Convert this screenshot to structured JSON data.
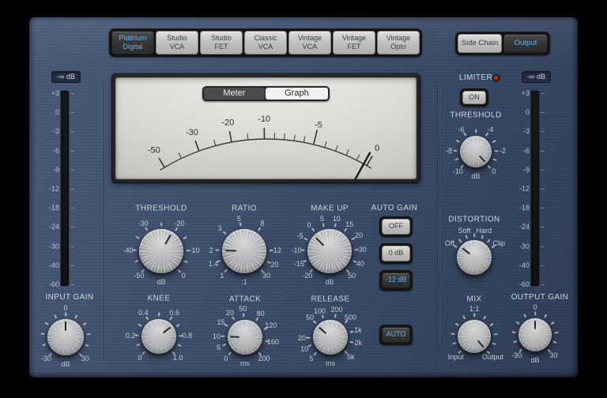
{
  "colors": {
    "accent_blue": "#6cb0ef",
    "panel_blue": "#3a4a66",
    "led_red": "#7c150d"
  },
  "model_selector": {
    "items": [
      {
        "lines": [
          "Platinum",
          "Digital"
        ],
        "selected": true
      },
      {
        "lines": [
          "Studio",
          "VCA"
        ],
        "selected": false
      },
      {
        "lines": [
          "Studio",
          "FET"
        ],
        "selected": false
      },
      {
        "lines": [
          "Classic",
          "VCA"
        ],
        "selected": false
      },
      {
        "lines": [
          "Vintage",
          "VCA"
        ],
        "selected": false
      },
      {
        "lines": [
          "Vintage",
          "FET"
        ],
        "selected": false
      },
      {
        "lines": [
          "Vintage",
          "Opto"
        ],
        "selected": false
      }
    ]
  },
  "output_selector": {
    "items": [
      {
        "label": "Side Chain",
        "selected": false
      },
      {
        "label": "Output",
        "selected": true
      }
    ]
  },
  "vu": {
    "tabs": [
      {
        "label": "Meter",
        "selected": true
      },
      {
        "label": "Graph",
        "selected": false
      }
    ],
    "scale": {
      "major": [
        {
          "text": "-50",
          "angle": -31
        },
        {
          "text": "-30",
          "angle": -20
        },
        {
          "text": "-20",
          "angle": -10.3
        },
        {
          "text": "-10",
          "angle": -0.8
        },
        {
          "text": "-5",
          "angle": 13.5,
          "long": true
        },
        {
          "text": "0",
          "angle": 30
        }
      ],
      "minor_angles": [
        -25.5,
        -15,
        -5.5,
        2.1,
        4.9,
        7.8,
        10.6,
        16.8,
        20.1,
        23.4,
        26.7
      ],
      "needle_angle": 29
    }
  },
  "meters": {
    "input": {
      "top_label": "-∞ dB",
      "ticks": [
        "+3",
        "0",
        "-3",
        "-6",
        "-9",
        "-12",
        "-18",
        "-24",
        "-30",
        "-40",
        "-60"
      ],
      "bottom_label": "INPUT GAIN"
    },
    "output": {
      "top_label": "-∞ dB",
      "ticks": [
        "+3",
        "0",
        "-3",
        "-6",
        "-9",
        "-12",
        "-18",
        "-24",
        "-30",
        "-40",
        "-60"
      ],
      "bottom_label": "OUTPUT GAIN"
    }
  },
  "auto_gain": {
    "label": "AUTO GAIN",
    "options": [
      {
        "label": "OFF",
        "selected": false
      },
      {
        "label": "0 dB",
        "selected": false
      },
      {
        "label": "-12 dB",
        "selected": true
      }
    ]
  },
  "release_auto": {
    "buttons": [
      {
        "label": "AUTO",
        "selected": true
      }
    ]
  },
  "limiter": {
    "label": "LIMITER",
    "buttons": [
      {
        "label": "ON",
        "selected": false
      }
    ]
  },
  "knobs": {
    "threshold": {
      "title": "THRESHOLD",
      "unit": "dB",
      "pointer": 30,
      "labels": [
        {
          "t": "-50",
          "a": -138
        },
        {
          "t": "-40",
          "a": -88
        },
        {
          "t": "-30",
          "a": -33
        },
        {
          "t": "-20",
          "a": 33
        },
        {
          "t": "-10",
          "a": 88
        },
        {
          "t": "0",
          "a": 138
        }
      ]
    },
    "ratio": {
      "title": "RATIO",
      "unit": ":1",
      "pointer": -88,
      "labels": [
        {
          "t": "1",
          "a": -138
        },
        {
          "t": "1.4",
          "a": -112
        },
        {
          "t": "2",
          "a": -88
        },
        {
          "t": "3",
          "a": -47
        },
        {
          "t": "5",
          "a": -9
        },
        {
          "t": "8",
          "a": 33
        },
        {
          "t": "12",
          "a": 88
        },
        {
          "t": "20",
          "a": 114
        },
        {
          "t": "30",
          "a": 138
        }
      ]
    },
    "makeup": {
      "title": "MAKE UP",
      "unit": "dB",
      "pointer": -46,
      "labels": [
        {
          "t": "-20",
          "a": -138
        },
        {
          "t": "-15",
          "a": -113
        },
        {
          "t": "-10",
          "a": -88
        },
        {
          "t": "-5",
          "a": -63
        },
        {
          "t": "0",
          "a": -38
        },
        {
          "t": "5",
          "a": -13
        },
        {
          "t": "10",
          "a": 12
        },
        {
          "t": "15",
          "a": 37
        },
        {
          "t": "20",
          "a": 62
        },
        {
          "t": "30",
          "a": 87
        },
        {
          "t": "40",
          "a": 112
        },
        {
          "t": "50",
          "a": 138
        }
      ]
    },
    "knee": {
      "title": "KNEE",
      "unit": "",
      "pointer": 52,
      "labels": [
        {
          "t": "0",
          "a": -138
        },
        {
          "t": "0.2",
          "a": -88
        },
        {
          "t": "0.4",
          "a": -33
        },
        {
          "t": "0.6",
          "a": 33
        },
        {
          "t": "0.8",
          "a": 88
        },
        {
          "t": "1.0",
          "a": 138
        }
      ]
    },
    "attack": {
      "title": "ATTACK",
      "unit": "ms",
      "pointer": -88,
      "labels": [
        {
          "t": "0",
          "a": -138
        },
        {
          "t": "5",
          "a": -112
        },
        {
          "t": "10",
          "a": -88
        },
        {
          "t": "15",
          "a": -58
        },
        {
          "t": "20",
          "a": -32
        },
        {
          "t": "50",
          "a": -4
        },
        {
          "t": "80",
          "a": 33
        },
        {
          "t": "120",
          "a": 66
        },
        {
          "t": "160",
          "a": 100
        },
        {
          "t": "200",
          "a": 138
        }
      ]
    },
    "release": {
      "title": "RELEASE",
      "unit": "ms",
      "pointer": -49,
      "labels": [
        {
          "t": "5",
          "a": -138
        },
        {
          "t": "10",
          "a": -114
        },
        {
          "t": "20",
          "a": -92
        },
        {
          "t": "50",
          "a": -46
        },
        {
          "t": "100",
          "a": -22
        },
        {
          "t": "200",
          "a": 13
        },
        {
          "t": "500",
          "a": 45
        },
        {
          "t": "1k",
          "a": 76
        },
        {
          "t": "2k",
          "a": 102
        },
        {
          "t": "5k",
          "a": 134
        }
      ]
    },
    "input_gain": {
      "title": "",
      "unit": "dB",
      "pointer": 0,
      "labels": [
        {
          "t": "-30",
          "a": -138
        },
        {
          "t": "0",
          "a": 0
        },
        {
          "t": "30",
          "a": 138
        }
      ]
    },
    "lim_threshold": {
      "title": "THRESHOLD",
      "unit": "dB",
      "pointer": 138,
      "labels": [
        {
          "t": "-10",
          "a": -138
        },
        {
          "t": "-8",
          "a": -88
        },
        {
          "t": "-6",
          "a": -33
        },
        {
          "t": "-4",
          "a": 33
        },
        {
          "t": "-2",
          "a": 88
        },
        {
          "t": "0",
          "a": 138
        }
      ]
    },
    "distortion": {
      "title": "DISTORTION",
      "unit": "",
      "pointer": -52,
      "labels": [
        {
          "t": "Off",
          "a": -60
        },
        {
          "t": "Soft",
          "a": -20
        },
        {
          "t": "Hard",
          "a": 20
        },
        {
          "t": "Clip",
          "a": 60
        }
      ]
    },
    "mix": {
      "title": "MIX",
      "unit": "",
      "pointer": 139,
      "labels": [
        {
          "t": "Input",
          "a": -138
        },
        {
          "t": "1:1",
          "a": 0
        },
        {
          "t": "Output",
          "a": 138
        }
      ]
    },
    "output_gain": {
      "title": "",
      "unit": "dB",
      "pointer": 0,
      "labels": [
        {
          "t": "-30",
          "a": -138
        },
        {
          "t": "0",
          "a": 0
        },
        {
          "t": "30",
          "a": 138
        }
      ]
    }
  }
}
